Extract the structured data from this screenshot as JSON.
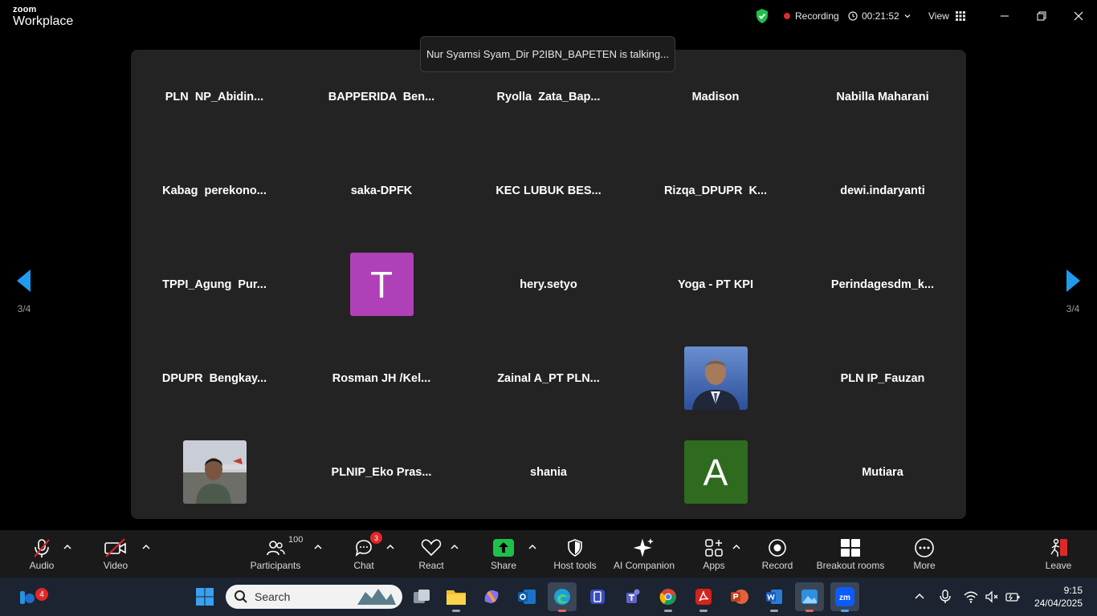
{
  "app": {
    "brand_small": "zoom",
    "brand_big": "Workplace"
  },
  "titlebar": {
    "recording_label": "Recording",
    "timer": "00:21:52",
    "view_label": "View"
  },
  "talking_banner": "Nur Syamsi Syam_Dir P2IBN_BAPETEN is talking...",
  "pager": {
    "left": "3/4",
    "right": "3/4"
  },
  "participants": [
    {
      "name": "PLN  NP_Abidin..."
    },
    {
      "name": "BAPPERIDA  Ben..."
    },
    {
      "name": "Ryolla  Zata_Bap..."
    },
    {
      "name": "Madison"
    },
    {
      "name": "Nabilla Maharani"
    },
    {
      "name": "Kabag  perekono..."
    },
    {
      "name": "saka-DPFK"
    },
    {
      "name": "KEC LUBUK BES..."
    },
    {
      "name": "Rizqa_DPUPR  K..."
    },
    {
      "name": "dewi.indaryanti"
    },
    {
      "name": "TPPI_Agung  Pur..."
    },
    {
      "avatar_letter": "T",
      "avatar_color": "#b040b8"
    },
    {
      "name": "hery.setyo"
    },
    {
      "name": "Yoga - PT KPI"
    },
    {
      "name": "Perindagesdm_k..."
    },
    {
      "name": "DPUPR  Bengkay..."
    },
    {
      "name": "Rosman JH /Kel..."
    },
    {
      "name": "Zainal A_PT PLN..."
    },
    {
      "photo": "man-in-suit"
    },
    {
      "name": "PLN IP_Fauzan"
    },
    {
      "photo": "man-outdoors"
    },
    {
      "name": "PLNIP_Eko Pras..."
    },
    {
      "name": "shania"
    },
    {
      "avatar_letter": "A",
      "avatar_color": "#2e6b1f"
    },
    {
      "name": "Mutiara"
    }
  ],
  "toolbar": {
    "audio": "Audio",
    "video": "Video",
    "participants": "Participants",
    "participants_count": "100",
    "chat": "Chat",
    "chat_badge": "3",
    "react": "React",
    "share": "Share",
    "host_tools": "Host tools",
    "ai_companion": "AI Companion",
    "apps": "Apps",
    "record": "Record",
    "breakout": "Breakout rooms",
    "more": "More",
    "leave": "Leave"
  },
  "taskbar": {
    "notification_count": "4",
    "search_placeholder": "Search",
    "time": "9:15",
    "date": "24/04/2025",
    "colors": {
      "accent": "#0b6efd",
      "bg": "#1b2430"
    }
  }
}
